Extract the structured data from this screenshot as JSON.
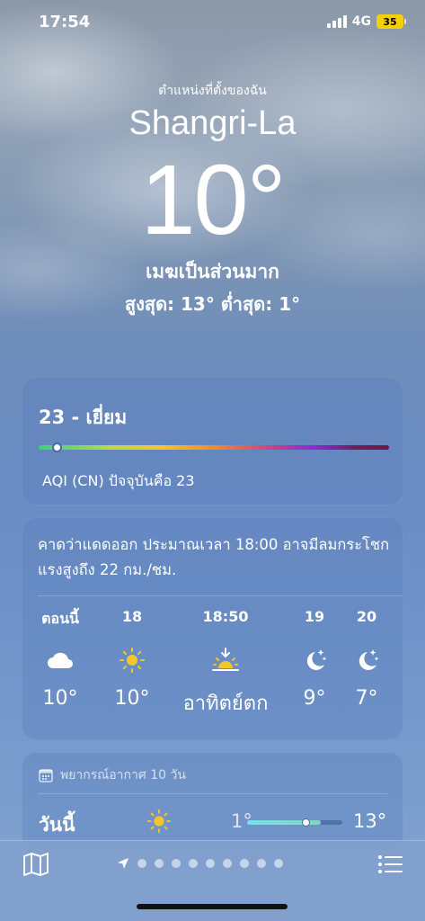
{
  "status_bar": {
    "time": "17:54",
    "network": "4G",
    "battery": "35"
  },
  "header": {
    "location_label": "ตำแหน่งที่ตั้งของฉัน",
    "city": "Shangri-La",
    "temperature": "10°",
    "condition": "เมฆเป็นส่วนมาก",
    "high_low": "สูงสุด: 13°  ต่ำสุด: 1°"
  },
  "aqi": {
    "title": "23 - เยี่ยม",
    "subtitle": "AQI (CN) ปัจจุบันคือ 23",
    "value": 23
  },
  "hourly": {
    "description": "คาดว่าแดดออก ประมาณเวลา 18:00 อาจมีลมกระโชกแรงสูงถึง 22 กม./ชม.",
    "items": [
      {
        "label": "ตอนนี้",
        "icon": "cloud-icon",
        "temp": "10°"
      },
      {
        "label": "18",
        "icon": "sun-icon",
        "temp": "10°"
      },
      {
        "label": "18:50",
        "icon": "sunset-icon",
        "temp": "อาทิตย์ตก"
      },
      {
        "label": "19",
        "icon": "moon-stars-icon",
        "temp": "9°"
      },
      {
        "label": "20",
        "icon": "moon-stars-icon",
        "temp": "7°"
      }
    ]
  },
  "forecast": {
    "header": "พยากรณ์อากาศ 10 วัน",
    "today": {
      "day": "วันนี้",
      "icon": "sun-icon",
      "low": "1°",
      "high": "13°"
    }
  },
  "bottom_bar": {
    "page_count": 9,
    "current_page": 0
  },
  "colors": {
    "sun": "#f7c52b",
    "range_fill": "#7fdcea"
  }
}
